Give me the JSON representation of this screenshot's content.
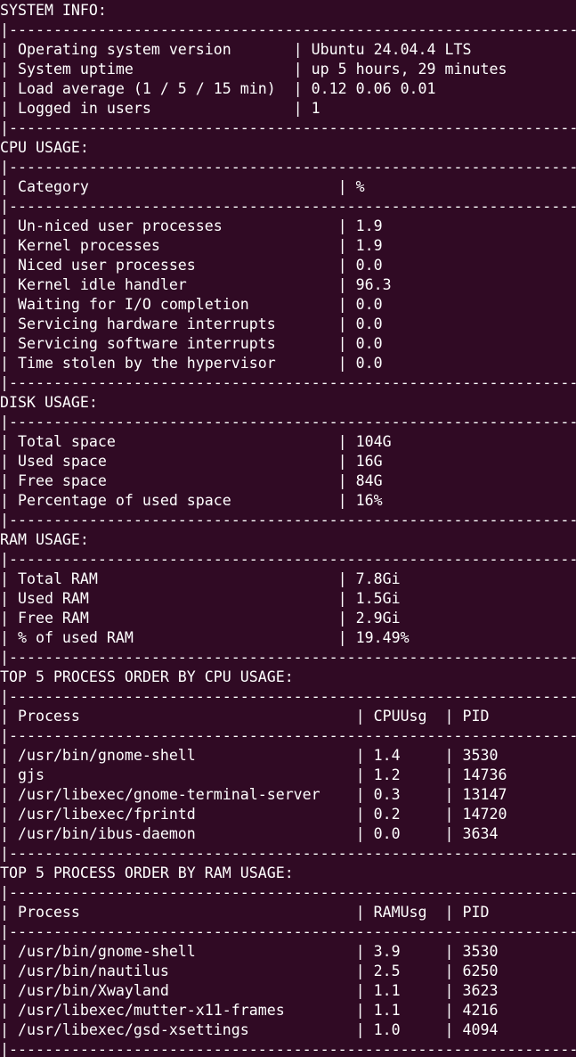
{
  "terminal": {
    "background": "#300a24",
    "foreground": "#ffffff",
    "lines": [
      "SYSTEM INFO:",
      "|------------------------------------------------------------------|",
      "| Operating system version       | Ubuntu 24.04.4 LTS              |",
      "| System uptime                  | up 5 hours, 29 minutes          |",
      "| Load average (1 / 5 / 15 min)  | 0.12 0.06 0.01                  |",
      "| Logged in users                | 1                               |",
      "|------------------------------------------------------------------|",
      "CPU USAGE:",
      "|------------------------------------------------------------------|",
      "| Category                            | %                          |",
      "|------------------------------------------------------------------|",
      "| Un-niced user processes             | 1.9                        |",
      "| Kernel processes                    | 1.9                        |",
      "| Niced user processes                | 0.0                        |",
      "| Kernel idle handler                 | 96.3                       |",
      "| Waiting for I/O completion          | 0.0                        |",
      "| Servicing hardware interrupts       | 0.0                        |",
      "| Servicing software interrupts       | 0.0                        |",
      "| Time stolen by the hypervisor       | 0.0                        |",
      "|------------------------------------------------------------------|",
      "DISK USAGE:",
      "|------------------------------------------------------------------|",
      "| Total space                         | 104G                       |",
      "| Used space                          | 16G                        |",
      "| Free space                          | 84G                        |",
      "| Percentage of used space            | 16%                        |",
      "|------------------------------------------------------------------|",
      "RAM USAGE:",
      "|------------------------------------------------------------------|",
      "| Total RAM                           | 7.8Gi                      |",
      "| Used RAM                            | 1.5Gi                      |",
      "| Free RAM                            | 2.9Gi                      |",
      "| % of used RAM                       | 19.49%                     |",
      "|------------------------------------------------------------------|",
      "TOP 5 PROCESS ORDER BY CPU USAGE:",
      "|------------------------------------------------------------------|",
      "| Process                               | CPUUsg  | PID            |",
      "|------------------------------------------------------------------|",
      "| /usr/bin/gnome-shell                  | 1.4     | 3530           |",
      "| gjs                                   | 1.2     | 14736          |",
      "| /usr/libexec/gnome-terminal-server    | 0.3     | 13147          |",
      "| /usr/libexec/fprintd                  | 0.2     | 14720          |",
      "| /usr/bin/ibus-daemon                  | 0.0     | 3634           |",
      "|------------------------------------------------------------------|",
      "TOP 5 PROCESS ORDER BY RAM USAGE:",
      "|------------------------------------------------------------------|",
      "| Process                               | RAMUsg  | PID            |",
      "|------------------------------------------------------------------|",
      "| /usr/bin/gnome-shell                  | 3.9     | 3530           |",
      "| /usr/bin/nautilus                     | 2.5     | 6250           |",
      "| /usr/bin/Xwayland                     | 1.1     | 3623           |",
      "| /usr/libexec/mutter-x11-frames        | 1.1     | 4216           |",
      "| /usr/libexec/gsd-xsettings            | 1.0     | 4094           |",
      "|------------------------------------------------------------------|"
    ]
  }
}
